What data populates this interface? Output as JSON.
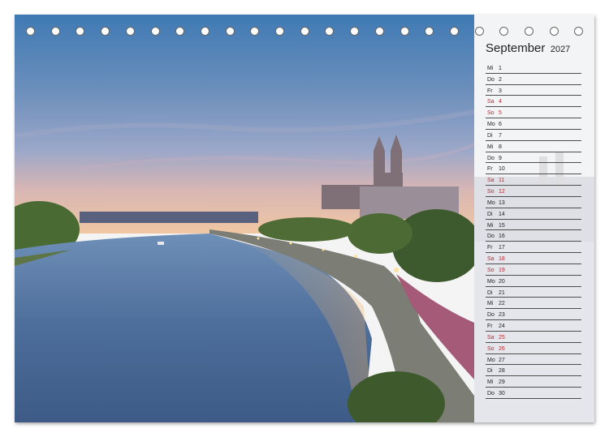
{
  "calendar": {
    "month": "September",
    "year": "2027",
    "days": [
      {
        "wd": "Mi",
        "d": "1",
        "weekend": false
      },
      {
        "wd": "Do",
        "d": "2",
        "weekend": false
      },
      {
        "wd": "Fr",
        "d": "3",
        "weekend": false
      },
      {
        "wd": "Sa",
        "d": "4",
        "weekend": true
      },
      {
        "wd": "So",
        "d": "5",
        "weekend": true
      },
      {
        "wd": "Mo",
        "d": "6",
        "weekend": false
      },
      {
        "wd": "Di",
        "d": "7",
        "weekend": false
      },
      {
        "wd": "Mi",
        "d": "8",
        "weekend": false
      },
      {
        "wd": "Do",
        "d": "9",
        "weekend": false
      },
      {
        "wd": "Fr",
        "d": "10",
        "weekend": false
      },
      {
        "wd": "Sa",
        "d": "11",
        "weekend": true
      },
      {
        "wd": "So",
        "d": "12",
        "weekend": true
      },
      {
        "wd": "Mo",
        "d": "13",
        "weekend": false
      },
      {
        "wd": "Di",
        "d": "14",
        "weekend": false
      },
      {
        "wd": "Mi",
        "d": "15",
        "weekend": false
      },
      {
        "wd": "Do",
        "d": "16",
        "weekend": false
      },
      {
        "wd": "Fr",
        "d": "17",
        "weekend": false
      },
      {
        "wd": "Sa",
        "d": "18",
        "weekend": true
      },
      {
        "wd": "So",
        "d": "19",
        "weekend": true
      },
      {
        "wd": "Mo",
        "d": "20",
        "weekend": false
      },
      {
        "wd": "Di",
        "d": "21",
        "weekend": false
      },
      {
        "wd": "Mi",
        "d": "22",
        "weekend": false
      },
      {
        "wd": "Do",
        "d": "23",
        "weekend": false
      },
      {
        "wd": "Fr",
        "d": "24",
        "weekend": false
      },
      {
        "wd": "Sa",
        "d": "25",
        "weekend": true
      },
      {
        "wd": "So",
        "d": "26",
        "weekend": true
      },
      {
        "wd": "Mo",
        "d": "27",
        "weekend": false
      },
      {
        "wd": "Di",
        "d": "28",
        "weekend": false
      },
      {
        "wd": "Mi",
        "d": "29",
        "weekend": false
      },
      {
        "wd": "Do",
        "d": "30",
        "weekend": false
      }
    ]
  },
  "binding": {
    "ring_count": 23
  },
  "colors": {
    "weekend": "#c0272d",
    "weekday": "#222222",
    "rule": "#4d4d4d"
  }
}
